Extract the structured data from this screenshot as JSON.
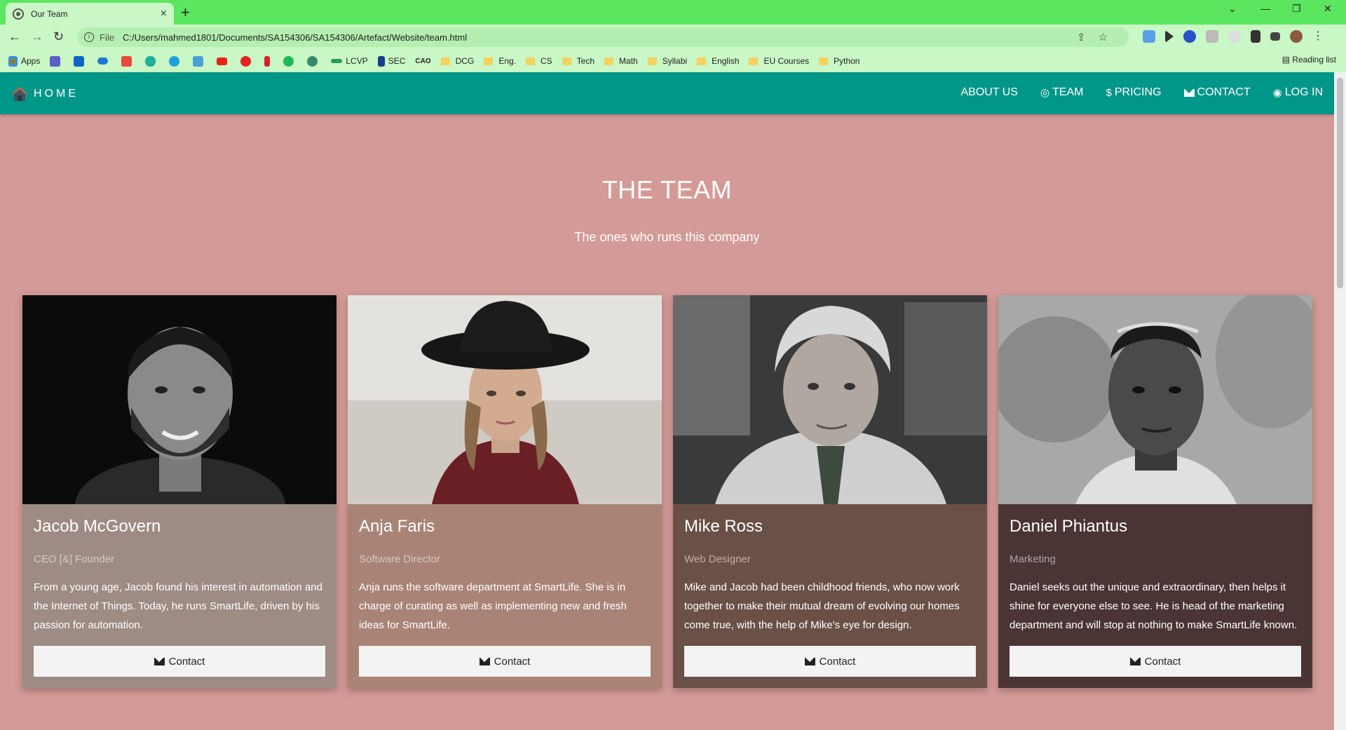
{
  "browser": {
    "tab_title": "Our Team",
    "tab_close": "×",
    "new_tab": "+",
    "protocol_label": "File",
    "url": "C:/Users/mahmed1801/Documents/SA154306/SA154306/Artefact/Website/team.html",
    "bookmarks": [
      "Apps",
      "LCVP",
      "SEC",
      "CAO",
      "DCG",
      "Eng.",
      "CS",
      "Tech",
      "Math",
      "Syllabi",
      "English",
      "EU Courses",
      "Python"
    ],
    "reading_list": "Reading list"
  },
  "site": {
    "brand": "HOME",
    "nav": {
      "about": "ABOUT US",
      "team": "TEAM",
      "pricing": "PRICING",
      "contact": "CONTACT",
      "login": "LOG IN"
    },
    "pricing_symbol": "$"
  },
  "page": {
    "title": "THE TEAM",
    "subtitle": "The ones who runs this company"
  },
  "team": [
    {
      "name": "Jacob McGovern",
      "role": "CEO [&] Founder",
      "bio": "From a young age, Jacob found his interest in automation and the Internet of Things. Today, he runs SmartLife, driven by his passion for automation.",
      "button": "Contact",
      "bg": "#9e8c84"
    },
    {
      "name": "Anja Faris",
      "role": "Software Director",
      "bio": "Anja runs the software department at SmartLife. She is in charge of curating as well as implementing new and fresh ideas for SmartLife.",
      "button": "Contact",
      "bg": "#a98476"
    },
    {
      "name": "Mike Ross",
      "role": "Web Designer",
      "bio": "Mike and Jacob had been childhood friends, who now work together to make their mutual dream of evolving our homes come true, with the help of Mike's eye for design.",
      "button": "Contact",
      "bg": "#6b5048"
    },
    {
      "name": "Daniel Phiantus",
      "role": "Marketing",
      "bio": "Daniel seeks out the unique and extraordinary, then helps it shine for everyone else to see. He is head of the marketing department and will stop at nothing to make SmartLife known.",
      "button": "Contact",
      "bg": "#4b3434"
    }
  ],
  "colors": {
    "page_bg": "#d49a97",
    "navbar": "#009688",
    "browser_frame": "#5ce55f"
  }
}
